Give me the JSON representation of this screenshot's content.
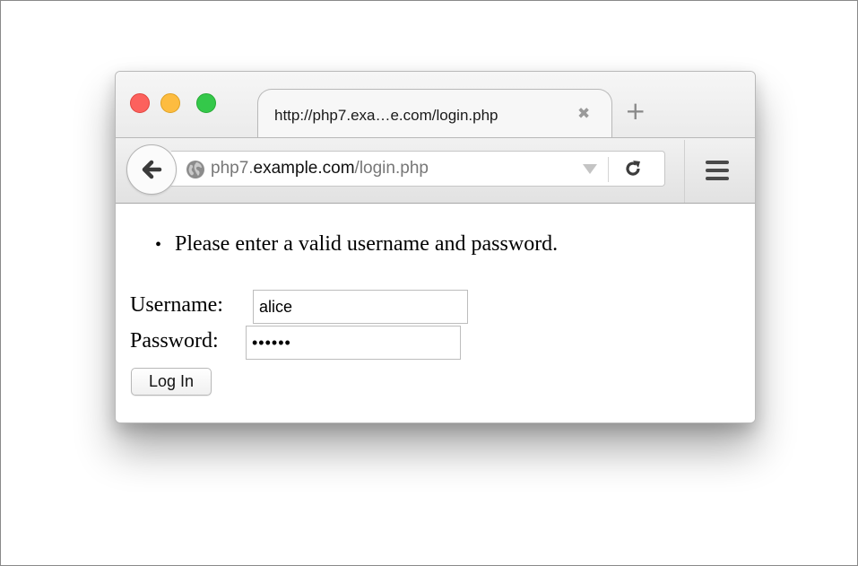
{
  "tab": {
    "title": "http://php7.exa…e.com/login.php",
    "close_glyph": "✖",
    "new_tab_glyph": "+"
  },
  "window_controls": {
    "close_color": "#fc615d",
    "minimize_color": "#fdbc40",
    "zoom_color": "#34c84a"
  },
  "urlbar": {
    "prefix": "php7.",
    "host": "example.com",
    "path": "/login.php",
    "site_icon": "globe-icon"
  },
  "toolbar": {
    "back_icon": "back-arrow-icon",
    "reload_icon": "reload-icon",
    "menu_icon": "hamburger-menu-icon"
  },
  "page": {
    "errors": [
      "Please enter a valid username and password."
    ],
    "username_label": "Username:",
    "username_value": "alice",
    "password_label": "Password:",
    "password_value": "••••••",
    "login_label": "Log In"
  }
}
